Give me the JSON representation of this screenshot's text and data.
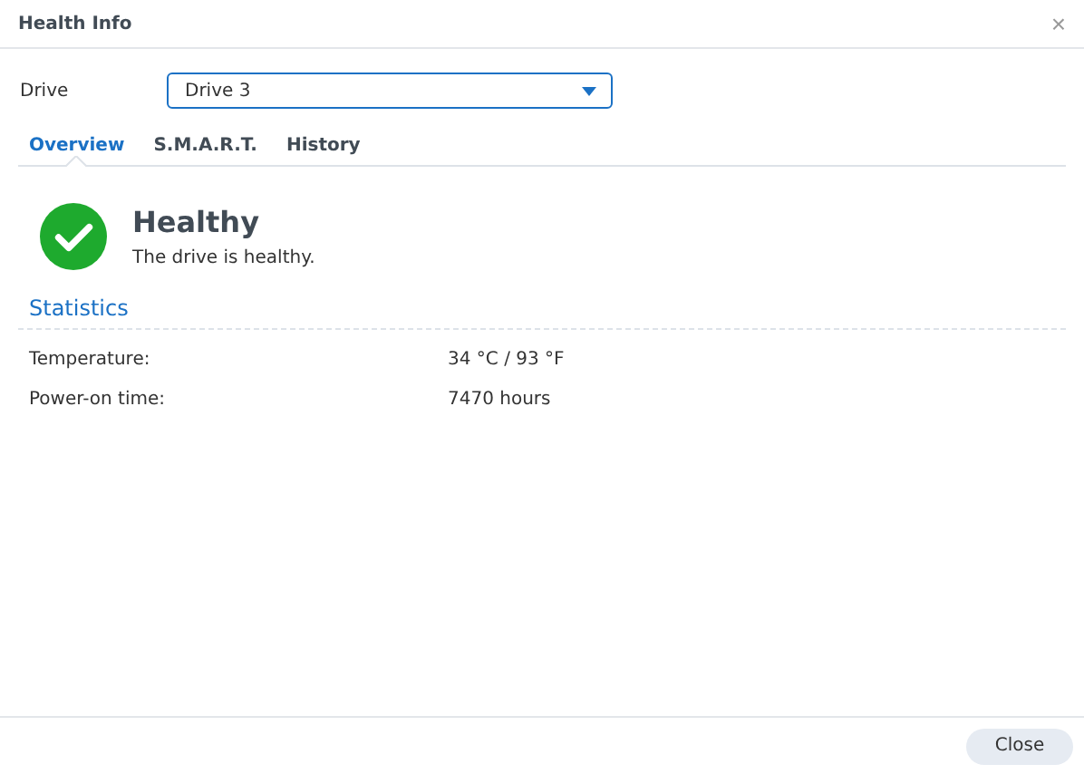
{
  "window": {
    "title": "Health Info",
    "close": "×"
  },
  "drive": {
    "label": "Drive",
    "value": "Drive 3"
  },
  "tabs": [
    {
      "label": "Overview",
      "selected": true
    },
    {
      "label": "S.M.A.R.T.",
      "selected": false
    },
    {
      "label": "History",
      "selected": false
    }
  ],
  "status": {
    "kind": "healthy",
    "title": "Healthy",
    "message": "The drive is healthy."
  },
  "statistics": {
    "heading": "Statistics",
    "rows": [
      {
        "label": "Temperature:",
        "value": "34 °C / 93 °F"
      },
      {
        "label": "Power-on time:",
        "value": "7470 hours"
      }
    ]
  },
  "buttons": [
    "Close"
  ]
}
